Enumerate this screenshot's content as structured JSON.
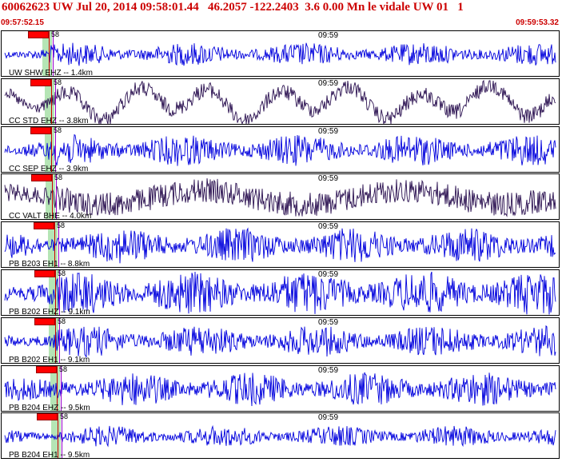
{
  "header": {
    "title": "60062623 UW Jul 20, 2014 09:58:01.44   46.2057 -122.2403  3.6 0.00 Mn le vidale UW 01   1",
    "start_time": "09:57:52.15",
    "end_time": "09:59:53.32"
  },
  "center_time_label": "09:59",
  "pick_time_label": "58",
  "colors": {
    "title": "#cc0000",
    "trace_blue": "#0000dd",
    "trace_dark": "#2a1050",
    "pick": "#ff0000",
    "band": "#a8e0a8"
  },
  "traces": [
    {
      "station": "UW SHW EHZ -- 1.4km",
      "color": "#0000dd",
      "amp": 0.22,
      "style": "hf",
      "pick_frac": 0.085
    },
    {
      "station": "CC STD EHZ -- 3.8km",
      "color": "#2a1050",
      "amp": 0.42,
      "style": "lf",
      "pick_frac": 0.088
    },
    {
      "station": "CC SEP EHZ -- 3.9km",
      "color": "#0000dd",
      "amp": 0.3,
      "style": "hf",
      "pick_frac": 0.088
    },
    {
      "station": "CC VALT BHE -- 4.0km",
      "color": "#2a1050",
      "amp": 0.38,
      "style": "mf",
      "pick_frac": 0.09
    },
    {
      "station": "PB B203 EH1 -- 8.8km",
      "color": "#0000dd",
      "amp": 0.34,
      "style": "hf",
      "pick_frac": 0.094
    },
    {
      "station": "PB B202 EHZ -- 9.1km",
      "color": "#0000dd",
      "amp": 0.42,
      "style": "hf",
      "pick_frac": 0.096
    },
    {
      "station": "PB B202 EH1 -- 9.1km",
      "color": "#0000dd",
      "amp": 0.3,
      "style": "hf",
      "pick_frac": 0.096
    },
    {
      "station": "PB B204 EHZ -- 9.5km",
      "color": "#0000dd",
      "amp": 0.32,
      "style": "hf",
      "pick_frac": 0.098
    },
    {
      "station": "PB B204 EH1 -- 9.5km",
      "color": "#0000dd",
      "amp": 0.2,
      "style": "hf",
      "pick_frac": 0.1
    }
  ]
}
